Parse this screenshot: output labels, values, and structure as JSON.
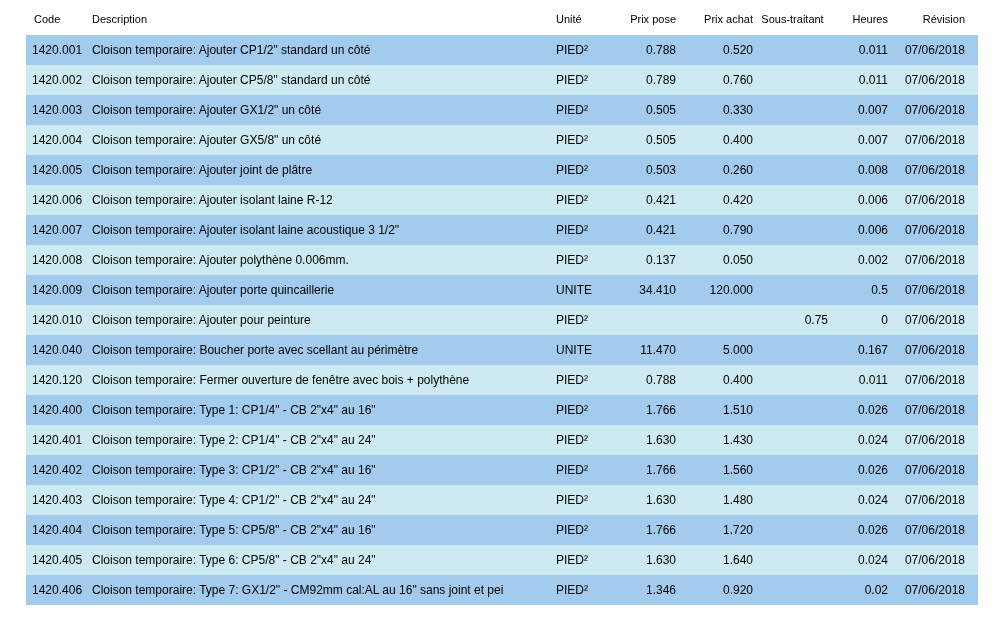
{
  "table": {
    "columns": [
      "Code",
      "Description",
      "Unité",
      "Prix pose",
      "Prix achat",
      "Sous-traitant",
      "Heures",
      "Révision"
    ],
    "rows": [
      [
        "1420.001",
        "Cloison temporaire: Ajouter CP1/2\" standard un côté",
        "PIED²",
        "0.788",
        "0.520",
        "",
        "0.011",
        "07/06/2018"
      ],
      [
        "1420.002",
        "Cloison temporaire: Ajouter CP5/8\" standard un côté",
        "PIED²",
        "0.789",
        "0.760",
        "",
        "0.011",
        "07/06/2018"
      ],
      [
        "1420.003",
        "Cloison temporaire: Ajouter GX1/2\" un côté",
        "PIED²",
        "0.505",
        "0.330",
        "",
        "0.007",
        "07/06/2018"
      ],
      [
        "1420.004",
        "Cloison temporaire: Ajouter GX5/8\" un côté",
        "PIED²",
        "0.505",
        "0.400",
        "",
        "0.007",
        "07/06/2018"
      ],
      [
        "1420.005",
        "Cloison temporaire: Ajouter joint de plâtre",
        "PIED²",
        "0.503",
        "0.260",
        "",
        "0.008",
        "07/06/2018"
      ],
      [
        "1420.006",
        "Cloison temporaire: Ajouter isolant laine R-12",
        "PIED²",
        "0.421",
        "0.420",
        "",
        "0.006",
        "07/06/2018"
      ],
      [
        "1420.007",
        "Cloison temporaire: Ajouter isolant laine acoustique 3 1/2\"",
        "PIED²",
        "0.421",
        "0.790",
        "",
        "0.006",
        "07/06/2018"
      ],
      [
        "1420.008",
        "Cloison temporaire: Ajouter polythène 0.006mm.",
        "PIED²",
        "0.137",
        "0.050",
        "",
        "0.002",
        "07/06/2018"
      ],
      [
        "1420.009",
        "Cloison temporaire: Ajouter porte quincaillerie",
        "UNITE",
        "34.410",
        "120.000",
        "",
        "0.5",
        "07/06/2018"
      ],
      [
        "1420.010",
        "Cloison temporaire: Ajouter pour peinture",
        "PIED²",
        "",
        "",
        "0.75",
        "0",
        "07/06/2018"
      ],
      [
        "1420.040",
        "Cloison temporaire: Boucher porte avec scellant au périmètre",
        "UNITE",
        "11.470",
        "5.000",
        "",
        "0.167",
        "07/06/2018"
      ],
      [
        "1420.120",
        "Cloison temporaire: Fermer ouverture de fenêtre avec bois + polythène",
        "PIED²",
        "0.788",
        "0.400",
        "",
        "0.011",
        "07/06/2018"
      ],
      [
        "1420.400",
        "Cloison temporaire: Type 1: CP1/4\" - CB 2\"x4\" au 16\"",
        "PIED²",
        "1.766",
        "1.510",
        "",
        "0.026",
        "07/06/2018"
      ],
      [
        "1420.401",
        "Cloison temporaire: Type 2: CP1/4\" - CB 2\"x4\" au 24\"",
        "PIED²",
        "1.630",
        "1.430",
        "",
        "0.024",
        "07/06/2018"
      ],
      [
        "1420.402",
        "Cloison temporaire: Type 3: CP1/2\" - CB 2\"x4\" au 16\"",
        "PIED²",
        "1.766",
        "1.560",
        "",
        "0.026",
        "07/06/2018"
      ],
      [
        "1420.403",
        "Cloison temporaire: Type 4: CP1/2\" - CB 2\"x4\" au 24\"",
        "PIED²",
        "1.630",
        "1.480",
        "",
        "0.024",
        "07/06/2018"
      ],
      [
        "1420.404",
        "Cloison temporaire: Type 5: CP5/8\" - CB 2\"x4\" au 16\"",
        "PIED²",
        "1.766",
        "1.720",
        "",
        "0.026",
        "07/06/2018"
      ],
      [
        "1420.405",
        "Cloison temporaire: Type 6: CP5/8\" - CB 2\"x4\" au 24\"",
        "PIED²",
        "1.630",
        "1.640",
        "",
        "0.024",
        "07/06/2018"
      ],
      [
        "1420.406",
        "Cloison temporaire: Type 7: GX1/2\" - CM92mm cal:AL au 16\" sans joint et pei",
        "PIED²",
        "1.346",
        "0.920",
        "",
        "0.02",
        "07/06/2018"
      ]
    ]
  }
}
